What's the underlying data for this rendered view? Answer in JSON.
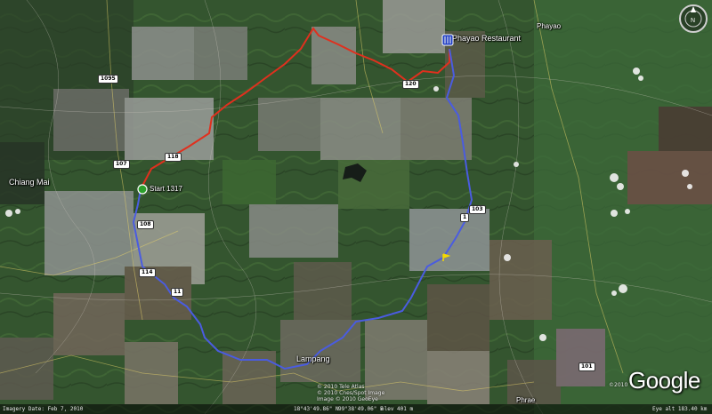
{
  "map": {
    "places": {
      "phayao": "Phayao",
      "phayao_restaurant": "Phayao Restaurant",
      "chiang_mai": "Chiang Mai",
      "start": "Start 1317",
      "lampang": "Lampang",
      "phrae": "Phrae"
    },
    "roads": {
      "r1095": "1095",
      "r107": "107",
      "r118": "118",
      "r120": "120",
      "r108": "108",
      "r114": "114",
      "r11": "11",
      "r1_east": "1",
      "r103": "103",
      "r101": "101"
    },
    "route_colors": {
      "red_route": "#e0301e",
      "blue_route": "#4a5ce0"
    },
    "copyright": {
      "line1": "© 2010 Tele Atlas",
      "line2": "© 2010 Cnes/Spot Image",
      "line3": "Image © 2010 GeoEye",
      "right": "©2010"
    },
    "logo": "Google",
    "status_bar": {
      "imagery_date": "Imagery Date: Feb 7, 2010",
      "lat": "18°43'49.86\" N",
      "lon": "99°38'49.06\" E",
      "elev": "elev  401 m",
      "eye_alt": "Eye alt  183.40 km"
    }
  }
}
